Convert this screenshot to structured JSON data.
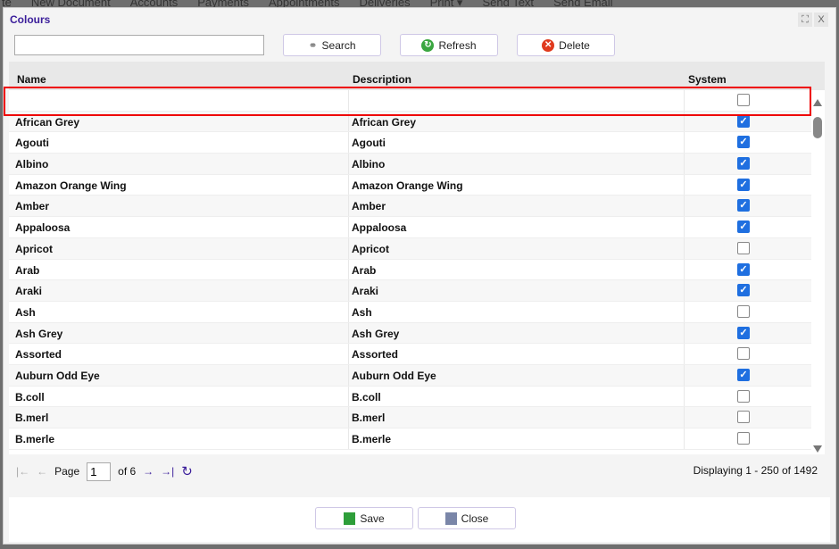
{
  "background_toolbar": [
    "te",
    "New Document",
    "Accounts",
    "Payments",
    "Appointments",
    "Deliveries",
    "Print ▾",
    "Send Text",
    "Send Email"
  ],
  "dialog": {
    "title": "Colours",
    "maximize_icon": "⛶",
    "close_icon": "X"
  },
  "toolbar": {
    "search_value": "",
    "search_label": "Search",
    "refresh_label": "Refresh",
    "delete_label": "Delete"
  },
  "grid": {
    "columns": [
      "Name",
      "Description",
      "System"
    ],
    "rows": [
      {
        "name": "",
        "description": "",
        "system": false
      },
      {
        "name": "African Grey",
        "description": "African Grey",
        "system": true
      },
      {
        "name": "Agouti",
        "description": "Agouti",
        "system": true
      },
      {
        "name": "Albino",
        "description": "Albino",
        "system": true
      },
      {
        "name": "Amazon Orange Wing",
        "description": "Amazon Orange Wing",
        "system": true
      },
      {
        "name": "Amber",
        "description": "Amber",
        "system": true
      },
      {
        "name": "Appaloosa",
        "description": "Appaloosa",
        "system": true
      },
      {
        "name": "Apricot",
        "description": "Apricot",
        "system": false
      },
      {
        "name": "Arab",
        "description": "Arab",
        "system": true
      },
      {
        "name": "Araki",
        "description": "Araki",
        "system": true
      },
      {
        "name": "Ash",
        "description": "Ash",
        "system": false
      },
      {
        "name": "Ash Grey",
        "description": "Ash Grey",
        "system": true
      },
      {
        "name": "Assorted",
        "description": "Assorted",
        "system": false
      },
      {
        "name": "Auburn Odd Eye",
        "description": "Auburn Odd Eye",
        "system": true
      },
      {
        "name": "B.coll",
        "description": "B.coll",
        "system": false
      },
      {
        "name": "B.merl",
        "description": "B.merl",
        "system": false
      },
      {
        "name": "B.merle",
        "description": "B.merle",
        "system": false
      }
    ]
  },
  "pager": {
    "page_label": "Page",
    "page": "1",
    "of_label": "of 6",
    "displaying": "Displaying 1 - 250 of 1492"
  },
  "footer": {
    "save_label": "Save",
    "close_label": "Close"
  },
  "colors": {
    "accent": "#3a1d9a",
    "checkbox": "#1f6fe0",
    "selection": "#e00000"
  }
}
